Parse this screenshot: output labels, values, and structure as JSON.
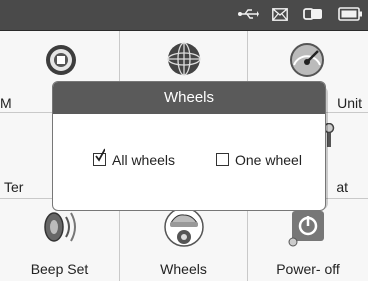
{
  "status_bar": {
    "icons": [
      "usb-icon",
      "mail-icon",
      "link-icon",
      "battery-icon"
    ],
    "glyphs": {
      "usb": "⭠",
      "mail": "✉"
    }
  },
  "grid": {
    "row1": [
      {
        "label": "M",
        "icon": "globe-chip-icon"
      },
      {
        "label": "",
        "icon": "globe-icon"
      },
      {
        "label": "Unit",
        "icon": "gauge-icon"
      }
    ],
    "row2": [
      {
        "label": "Ter",
        "icon": ""
      },
      {
        "label": "",
        "icon": ""
      },
      {
        "label": "at",
        "icon": "wrench-icon"
      }
    ],
    "row3": [
      {
        "label": "Beep Set",
        "icon": "speaker-icon"
      },
      {
        "label": "Wheels",
        "icon": "car-wheel-icon"
      },
      {
        "label": "Power- off",
        "icon": "power-icon"
      }
    ]
  },
  "dialog": {
    "title": "Wheels",
    "options": [
      {
        "label": "All wheels",
        "checked": true
      },
      {
        "label": "One wheel",
        "checked": false
      }
    ]
  },
  "colors": {
    "statusbar": "#4a4a4a",
    "dialog_title": "#5a5a5a"
  }
}
